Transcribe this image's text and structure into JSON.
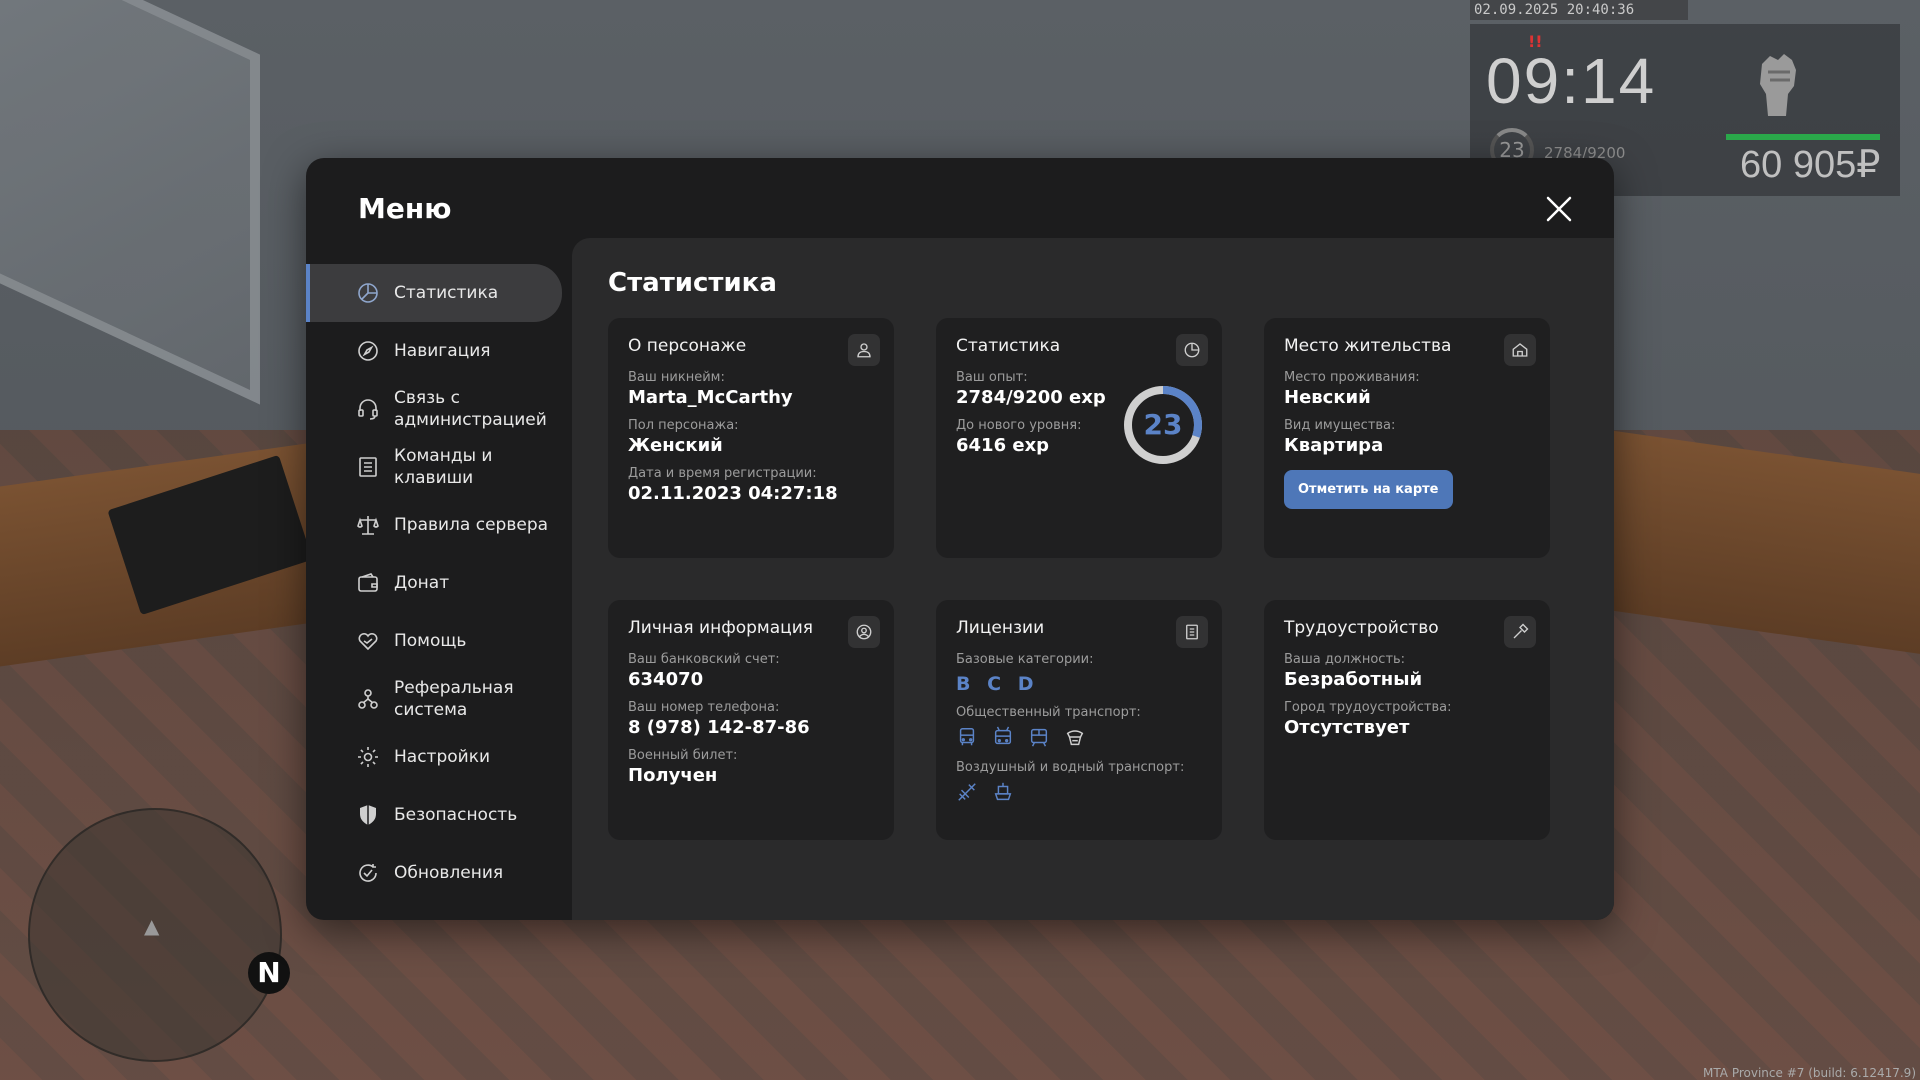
{
  "hud": {
    "datetime": "02.09.2025 20:40:36",
    "time": "09:14",
    "level": "23",
    "exp": "2784/9200",
    "money": "60 905₽",
    "colors": {
      "health": "#2aa84a"
    }
  },
  "minimap": {
    "north": "N"
  },
  "build": "MTA Province #7 (build: 6.12417.9)",
  "menu": {
    "title": "Меню",
    "close_icon": "close-icon",
    "nav": [
      {
        "label": "Статистика",
        "icon": "pie-chart-icon",
        "active": true
      },
      {
        "label": "Навигация",
        "icon": "compass-icon"
      },
      {
        "label": "Связь с администрацией",
        "icon": "headset-icon"
      },
      {
        "label": "Команды и клавиши",
        "icon": "list-icon"
      },
      {
        "label": "Правила сервера",
        "icon": "scales-icon"
      },
      {
        "label": "Донат",
        "icon": "wallet-icon"
      },
      {
        "label": "Помощь",
        "icon": "heart-hand-icon"
      },
      {
        "label": "Реферальная система",
        "icon": "network-icon"
      },
      {
        "label": "Настройки",
        "icon": "gear-icon"
      },
      {
        "label": "Безопасность",
        "icon": "shield-icon"
      },
      {
        "label": "Обновления",
        "icon": "refresh-check-icon"
      }
    ]
  },
  "page": {
    "title": "Статистика",
    "cards": {
      "character": {
        "title": "О персонаже",
        "icon": "user-icon",
        "nick_label": "Ваш никнейм:",
        "nick": "Marta_McCarthy",
        "gender_label": "Пол персонажа:",
        "gender": "Женский",
        "reg_label": "Дата и время регистрации:",
        "reg": "02.11.2023 04:27:18"
      },
      "stats": {
        "title": "Статистика",
        "icon": "pie-chart-icon",
        "exp_label": "Ваш опыт:",
        "exp": "2784/9200 exp",
        "next_label": "До нового уровня:",
        "next": "6416 exp",
        "level": "23",
        "progress": 0.3026
      },
      "residence": {
        "title": "Место жительства",
        "icon": "house-icon",
        "place_label": "Место проживания:",
        "place": "Невский",
        "type_label": "Вид имущества:",
        "type": "Квартира",
        "button": "Отметить на карте"
      },
      "personal": {
        "title": "Личная информация",
        "icon": "user-circle-icon",
        "bank_label": "Ваш банковский счет:",
        "bank": "634070",
        "phone_label": "Ваш номер телефона:",
        "phone": "8 (978) 142-87-86",
        "military_label": "Военный билет:",
        "military": "Получен"
      },
      "licenses": {
        "title": "Лицензии",
        "icon": "document-icon",
        "base_label": "Базовые категории:",
        "base": [
          "B",
          "C",
          "D"
        ],
        "public_label": "Общественный транспорт:",
        "public_icons": [
          "bus-icon",
          "trolleybus-icon",
          "tram-icon",
          "taxi-icon"
        ],
        "air_label": "Воздушный и водный транспорт:",
        "air_icons": [
          "plane-icon",
          "boat-icon"
        ]
      },
      "job": {
        "title": "Трудоустройство",
        "icon": "hammer-icon",
        "post_label": "Ваша должность:",
        "post": "Безработный",
        "city_label": "Город трудоустройства:",
        "city": "Отсутствует"
      }
    }
  },
  "colors": {
    "accent": "#5b83c7",
    "button": "#4e77b8",
    "modal": "#1c1c1d",
    "content": "#2a2a2b",
    "card": "#1f1f20"
  }
}
